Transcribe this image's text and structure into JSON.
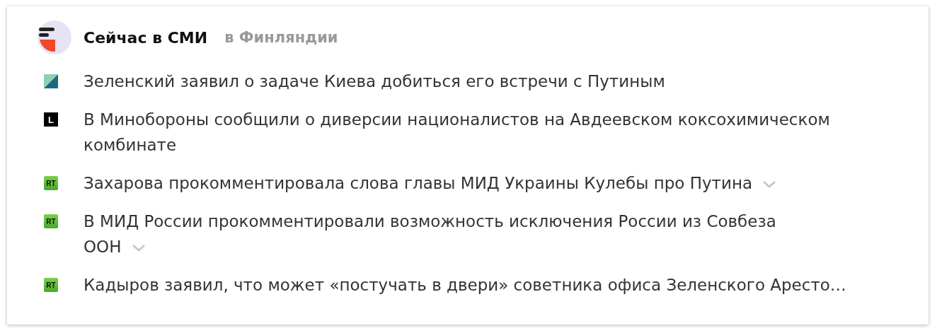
{
  "header": {
    "title": "Сейчас в СМИ",
    "region": "в Финляндии"
  },
  "news": [
    {
      "source": {
        "kind": "diamond"
      },
      "headline": "Зеленский заявил о задаче Киева добиться его встречи с Путиным",
      "expandable": false
    },
    {
      "source": {
        "kind": "letter",
        "text": "L"
      },
      "headline": "В Минобороны сообщили о диверсии националистов на Авдеевском коксохимическом комбинате",
      "expandable": false
    },
    {
      "source": {
        "kind": "badge",
        "text": "RT"
      },
      "headline": "Захарова прокомментировала слова главы МИД Украины Кулебы про Путина",
      "expandable": true
    },
    {
      "source": {
        "kind": "badge",
        "text": "RT"
      },
      "headline": "В МИД России прокомментировали возможность исключения России из Совбеза ООН",
      "expandable": true
    },
    {
      "source": {
        "kind": "badge",
        "text": "RT"
      },
      "headline": "Кадыров заявил, что может «постучать в двери» советника офиса Зеленского Аресто…",
      "expandable": false
    }
  ]
}
